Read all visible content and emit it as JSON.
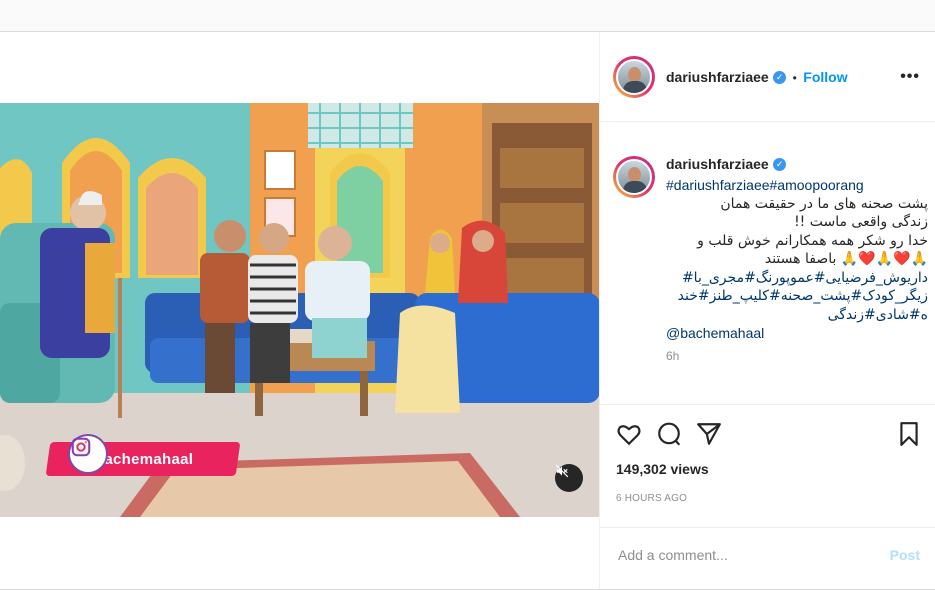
{
  "post": {
    "username": "dariushfarziaee",
    "verified_icon": "verified-badge-icon",
    "follow_label": "Follow",
    "dot_separator": "•",
    "more_icon": "•••",
    "caption": {
      "hashtags_line": "#dariushfarziaee#amoopoorang",
      "lines": [
        "پشت صحنه های ما در حقیقت همان",
        "زندگی واقعی ماست !!",
        "خدا رو شکر همه همکارانم خوش قلب و",
        "🙏❤️🙏❤️🙏 باصفا هستند",
        "داریوش_فرضیایی#عموپورنگ#مجری_با#",
        "زیگر_کودک#پشت_صحنه#کلیپ_طنز#خند",
        "ه#شادی#زندگی"
      ],
      "mention": "@bachemahaal",
      "timestamp_short": "6h"
    },
    "views": "149,302 views",
    "time_ago": "6 HOURS AGO",
    "comment_placeholder": "Add a comment...",
    "post_button": "Post"
  },
  "video": {
    "overlay_handle": "@bachemahaal",
    "mute_icon": "speaker-muted-icon"
  },
  "colors": {
    "link": "#0095f6",
    "hashtag": "#00376b",
    "badge": "#e8235d",
    "post_disabled": "#b2dffc"
  }
}
